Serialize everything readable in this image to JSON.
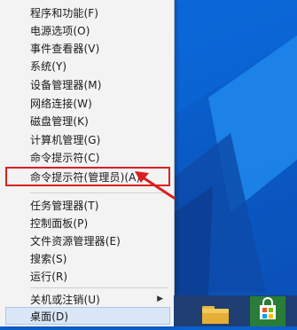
{
  "menu": {
    "items": [
      {
        "label": "程序和功能(F)"
      },
      {
        "label": "电源选项(O)"
      },
      {
        "label": "事件查看器(V)"
      },
      {
        "label": "系统(Y)"
      },
      {
        "label": "设备管理器(M)"
      },
      {
        "label": "网络连接(W)"
      },
      {
        "label": "磁盘管理(K)"
      },
      {
        "label": "计算机管理(G)"
      },
      {
        "label": "命令提示符(C)"
      },
      {
        "label": "命令提示符(管理员)(A)"
      },
      {
        "label": "任务管理器(T)"
      },
      {
        "label": "控制面板(P)"
      },
      {
        "label": "文件资源管理器(E)"
      },
      {
        "label": "搜索(S)"
      },
      {
        "label": "运行(R)"
      },
      {
        "label": "关机或注销(U)"
      },
      {
        "label": "桌面(D)"
      }
    ]
  },
  "colors": {
    "highlight_border": "#d82020",
    "desktop_blue": "#0a5fd0",
    "taskbar": "#1f3f73",
    "store_green": "#2a7c39"
  },
  "icons": {
    "submenu": "chevron-right-icon",
    "annotation": "red-arrow-icon",
    "taskbar_explorer": "folder-icon",
    "taskbar_store": "store-icon"
  }
}
